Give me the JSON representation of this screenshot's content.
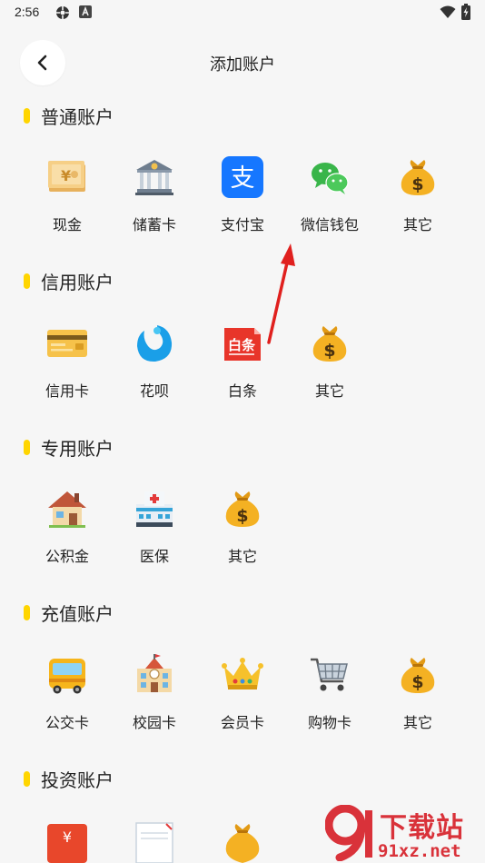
{
  "status_bar": {
    "time": "2:56"
  },
  "header": {
    "title": "添加账户"
  },
  "sections": [
    {
      "title": "普通账户",
      "items": [
        {
          "label": "现金",
          "icon": "cash-icon"
        },
        {
          "label": "储蓄卡",
          "icon": "bank-icon"
        },
        {
          "label": "支付宝",
          "icon": "alipay-icon"
        },
        {
          "label": "微信钱包",
          "icon": "wechat-icon"
        },
        {
          "label": "其它",
          "icon": "money-bag-icon"
        }
      ]
    },
    {
      "title": "信用账户",
      "items": [
        {
          "label": "信用卡",
          "icon": "credit-card-icon"
        },
        {
          "label": "花呗",
          "icon": "huabei-icon"
        },
        {
          "label": "白条",
          "icon": "baitiao-icon",
          "icon_text": "白条"
        },
        {
          "label": "其它",
          "icon": "money-bag-icon"
        }
      ]
    },
    {
      "title": "专用账户",
      "items": [
        {
          "label": "公积金",
          "icon": "house-icon"
        },
        {
          "label": "医保",
          "icon": "hospital-icon"
        },
        {
          "label": "其它",
          "icon": "money-bag-icon"
        }
      ]
    },
    {
      "title": "充值账户",
      "items": [
        {
          "label": "公交卡",
          "icon": "bus-icon"
        },
        {
          "label": "校园卡",
          "icon": "school-icon"
        },
        {
          "label": "会员卡",
          "icon": "crown-icon"
        },
        {
          "label": "购物卡",
          "icon": "shopping-cart-icon"
        },
        {
          "label": "其它",
          "icon": "money-bag-icon"
        }
      ]
    },
    {
      "title": "投资账户",
      "items": []
    }
  ],
  "watermark": {
    "brand": "下载站",
    "url": "91xz.net"
  },
  "colors": {
    "accent": "#ffd500",
    "arrow": "#e0201e",
    "background": "#f6f6f6"
  }
}
